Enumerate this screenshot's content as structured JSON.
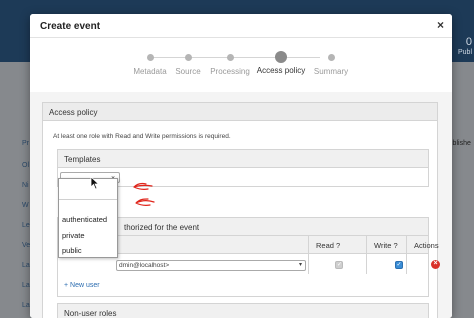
{
  "background": {
    "header_number": "0",
    "header_label": "Publ",
    "left_rows": [
      "Pr",
      "Ol",
      "Ni",
      "W",
      "Le",
      "Ve",
      "La",
      "La",
      "La"
    ],
    "right_label": "Publishe"
  },
  "modal": {
    "title": "Create event",
    "close_glyph": "×"
  },
  "wizard": {
    "steps": [
      {
        "label": "Metadata",
        "active": false
      },
      {
        "label": "Source",
        "active": false
      },
      {
        "label": "Processing",
        "active": false
      },
      {
        "label": "Access policy",
        "active": true
      },
      {
        "label": "Summary",
        "active": false
      }
    ]
  },
  "access_policy": {
    "heading": "Access policy",
    "info": "At least one role with Read and Write permissions is required.",
    "templates_heading": "Templates",
    "select_value": "",
    "dropdown_options": [
      "",
      "authenticated",
      "private",
      "public"
    ],
    "roles_heading": "thorized for the event",
    "columns": {
      "read": "Read ?",
      "write": "Write ?",
      "actions": "Actions"
    },
    "user_value": "dmin@localhost>",
    "new_user_label": "+ New user",
    "non_user_heading": "Non-user roles"
  },
  "colors": {
    "accent": "#3a8dd6",
    "danger": "#d9322a",
    "annotation": "#e0251b"
  }
}
